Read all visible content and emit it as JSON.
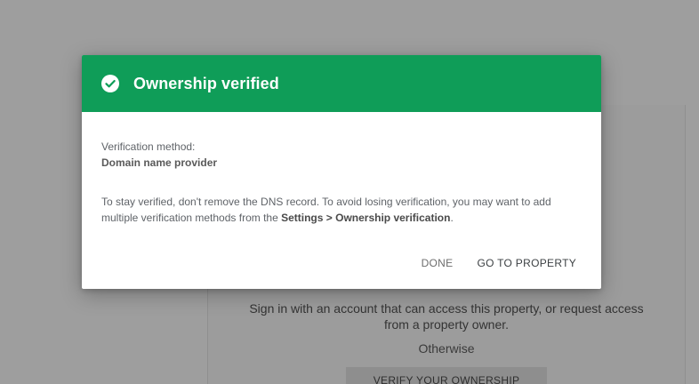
{
  "dialog": {
    "title": "Ownership verified",
    "method_label": "Verification method:",
    "method_value": "Domain name provider",
    "info_prefix": "To stay verified, don't remove the DNS record. To avoid losing verification, you may want to add multiple verification methods from the ",
    "info_bold": "Settings > Ownership verification",
    "info_suffix": ".",
    "done_label": "DONE",
    "go_label": "GO TO PROPERTY",
    "header_color": "#0f9d58"
  },
  "background": {
    "signin_line1": "Sign in with an account that can access this property, or request access",
    "signin_line2": "from a property owner.",
    "otherwise": "Otherwise",
    "verify_button": "VERIFY YOUR OWNERSHIP"
  },
  "icons": {
    "header_icon": "check-circle-icon"
  }
}
